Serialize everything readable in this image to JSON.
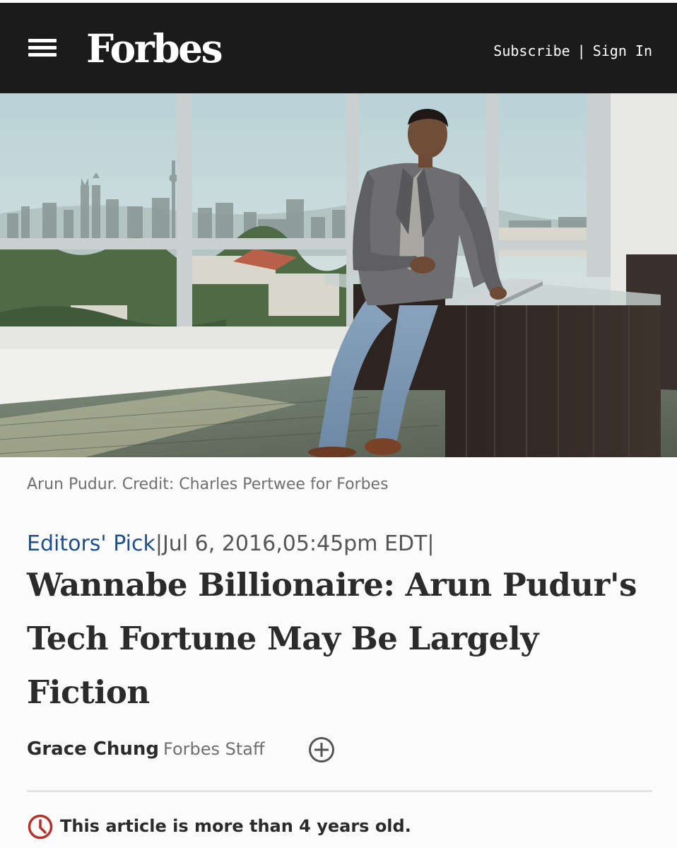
{
  "header": {
    "logo": "Forbes",
    "subscribe": "Subscribe",
    "separator": "|",
    "sign_in": "Sign In"
  },
  "hero": {
    "icons": [
      "menu-icon"
    ]
  },
  "caption": "Arun Pudur. Credit: Charles Pertwee for Forbes",
  "meta": {
    "category": "Editors' Pick",
    "separator1": "|",
    "datetime": "Jul 6, 2016,05:45pm EDT",
    "separator2": "|"
  },
  "headline": "Wannabe Billionaire: Arun Pudur's Tech Fortune May Be Largely Fiction",
  "byline": {
    "author": "Grace Chung",
    "role": "Forbes Staff",
    "follow_icon": "plus-circle-icon"
  },
  "notice": {
    "icon": "clock-icon",
    "text": "This article is more than 4 years old."
  },
  "colors": {
    "header_bg": "#1b1b1b",
    "category_link": "#1f4f8a",
    "notice_icon": "#b3322b"
  }
}
